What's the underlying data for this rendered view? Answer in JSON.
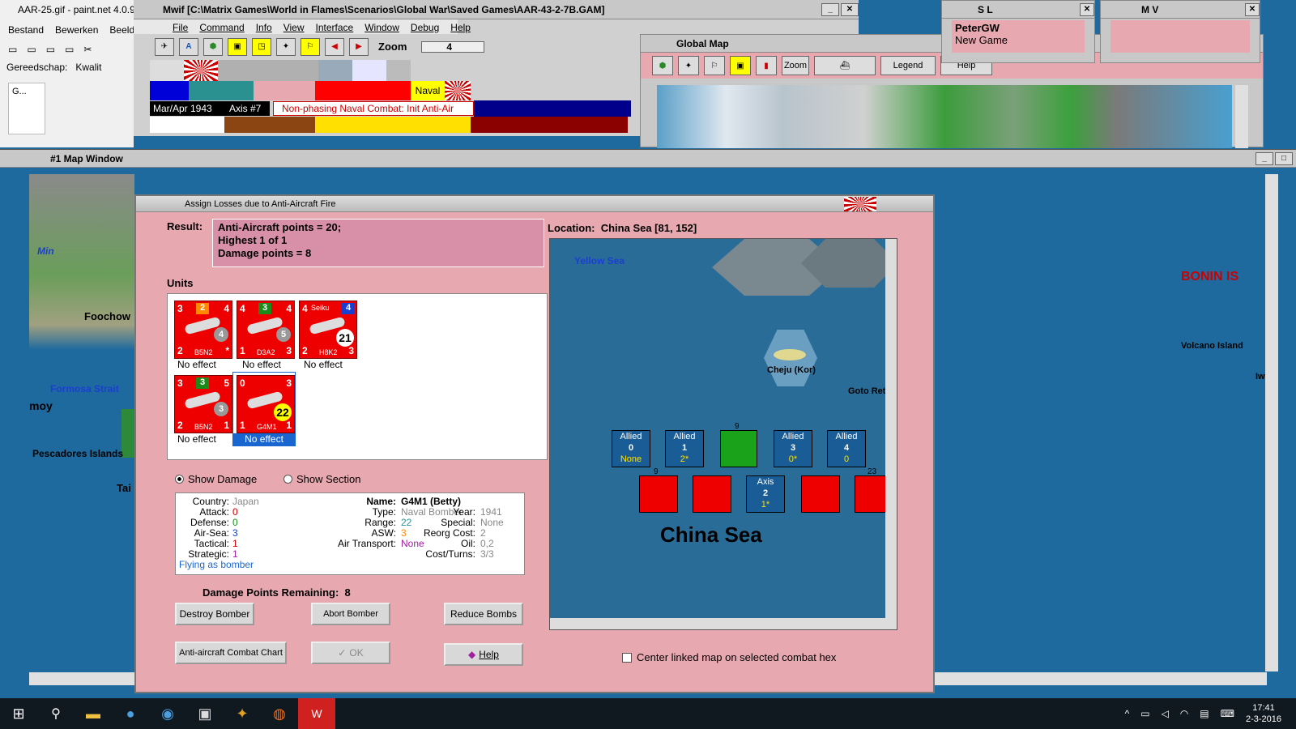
{
  "paintnet": {
    "title": "AAR-25.gif - paint.net 4.0.9",
    "menu": [
      "Bestand",
      "Bewerken",
      "Beeld"
    ],
    "gereedschap": "Gereedschap:",
    "kwaliteit": "Kwalit",
    "tool_text": "G..."
  },
  "mwif": {
    "title": "Mwif [C:\\Matrix Games\\World in Flames\\Scenarios\\Global War\\Saved Games\\AAR-43-2-7B.GAM]",
    "menu": [
      "File",
      "Command",
      "Info",
      "View",
      "Interface",
      "Window",
      "Debug",
      "Help"
    ],
    "zoom_label": "Zoom",
    "zoom_value": "4",
    "naval_label": "Naval",
    "date": "Mar/Apr 1943",
    "impulse": "Axis #7",
    "phase": "Non-phasing Naval Combat: Init Anti-Air"
  },
  "global_map": {
    "title": "Global Map",
    "zoom_label": "Zoom",
    "legend_label": "Legend",
    "help_label": "Help"
  },
  "sl_window": {
    "title": "S L",
    "player": "PeterGW",
    "game": "New Game"
  },
  "mv_window": {
    "title": "M V"
  },
  "map_window": {
    "title": "#1 Map Window",
    "labels": [
      "Min",
      "Foochow",
      "Formosa Strait",
      "moy",
      "Pescadores Islands",
      "Tai",
      "BONIN IS",
      "Volcano Island",
      "Iwo"
    ]
  },
  "dialog": {
    "title": "Assign Losses due to Anti-Aircraft Fire",
    "result_label": "Result:",
    "result_lines": [
      "Anti-Aircraft points = 20;",
      "Highest 1 of 1",
      "Damage points = 8"
    ],
    "units_label": "Units",
    "units": [
      {
        "name": "B5N2",
        "attack": "3",
        "top": "2",
        "right": "4",
        "circle": "4",
        "bottom_left": "2",
        "bottom_right": "*",
        "status": "No effect"
      },
      {
        "name": "D3A2",
        "attack": "4",
        "top": "3",
        "right": "4",
        "circle": "5",
        "bottom_left": "1",
        "bottom_right": "3",
        "status": "No effect"
      },
      {
        "name": "H8K2",
        "attack": "4",
        "top": "Seiku",
        "right": "4",
        "circle": "21",
        "bottom_left": "2",
        "bottom_right": "3",
        "status": "No effect"
      },
      {
        "name": "B5N2",
        "attack": "3",
        "top": "3",
        "right": "5",
        "circle": "3",
        "bottom_left": "2",
        "bottom_right": "1",
        "status": "No effect"
      },
      {
        "name": "G4M1",
        "attack": "0",
        "top": "",
        "right": "3",
        "circle": "22",
        "bottom_left": "1",
        "bottom_right": "1",
        "status": "No effect"
      }
    ],
    "show_damage": "Show Damage",
    "show_section": "Show Section",
    "details": {
      "country_label": "Country:",
      "country": "Japan",
      "attack_label": "Attack:",
      "attack": "0",
      "defense_label": "Defense:",
      "defense": "0",
      "airsea_label": "Air-Sea:",
      "airsea": "3",
      "tactical_label": "Tactical:",
      "tactical": "1",
      "strategic_label": "Strategic:",
      "strategic": "1",
      "flying": "Flying as bomber",
      "name_label": "Name:",
      "name": "G4M1 (Betty)",
      "type_label": "Type:",
      "type": "Naval Bomber",
      "year_label": "Year:",
      "year": "1941",
      "range_label": "Range:",
      "range": "22",
      "special_label": "Special:",
      "special": "None",
      "asw_label": "ASW:",
      "asw": "3",
      "reorg_label": "Reorg Cost:",
      "reorg": "2",
      "airtransport_label": "Air Transport:",
      "airtransport": "None",
      "oil_label": "Oil:",
      "oil": "0,2",
      "costturns_label": "Cost/Turns:",
      "costturns": "3/3"
    },
    "damage_remaining": "Damage Points Remaining:  8",
    "buttons": {
      "destroy": "Destroy Bomber",
      "abort": "Abort Bomber",
      "reduce": "Reduce Bombs",
      "chart": "Anti-aircraft Combat Chart",
      "ok": "OK",
      "help": "Help"
    },
    "location": "Location:  China Sea [81, 152]",
    "map_labels": {
      "yellow_sea": "Yellow Sea",
      "cheju": "Cheju (Kor)",
      "goto": "Goto Rett",
      "china_sea": "China Sea"
    },
    "trays": [
      {
        "side": "Allied",
        "num": "0",
        "val": "None"
      },
      {
        "side": "Allied",
        "num": "1",
        "val": "2*"
      },
      {
        "side": "Allied",
        "num": "3",
        "val": "0*"
      },
      {
        "side": "Allied",
        "num": "4",
        "val": "0"
      },
      {
        "side": "Axis",
        "num": "2",
        "val": "1*"
      }
    ],
    "stack_counts": {
      "green": "9",
      "red1": "9",
      "red_last": "23"
    },
    "center_linked": "Center linked map on selected combat hex"
  },
  "taskbar": {
    "time": "17:41",
    "date": "2-3-2016"
  }
}
